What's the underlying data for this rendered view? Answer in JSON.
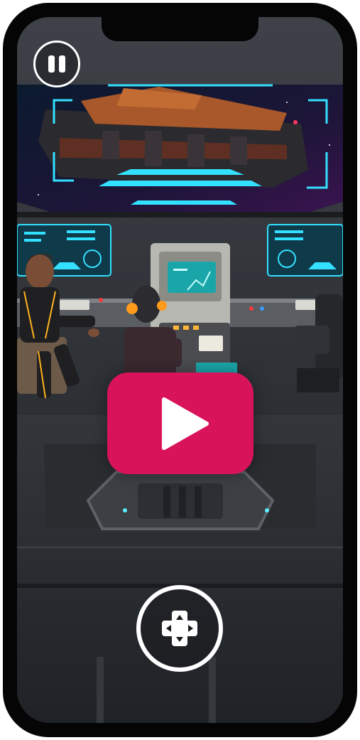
{
  "game": {
    "scene": "spaceship-bridge",
    "controls": {
      "pause_icon": "pause-icon",
      "play_icon": "play-icon",
      "move_icon": "dpad-icon"
    },
    "colors": {
      "play_button": "#d9135a",
      "hologram_cyan": "#33e0ff",
      "accent_orange": "#ff9a1c"
    }
  }
}
